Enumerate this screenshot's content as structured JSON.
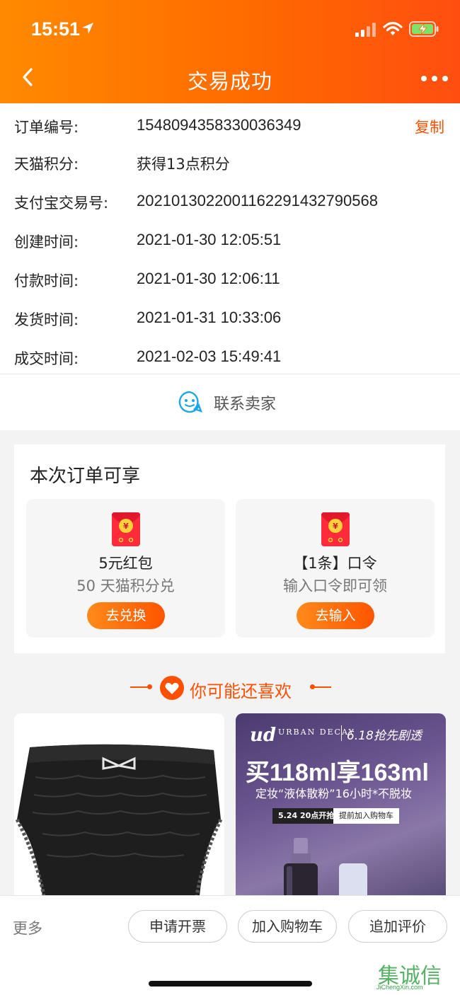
{
  "status_bar": {
    "time": "15:51"
  },
  "header": {
    "title": "交易成功"
  },
  "order": {
    "rows": [
      {
        "key": "订单编号:",
        "value": "1548094358330036349"
      },
      {
        "key": "天猫积分:",
        "value": "获得13点积分"
      },
      {
        "key": "支付宝交易号:",
        "value": "2021013022001162291432790568"
      },
      {
        "key": "创建时间:",
        "value": "2021-01-30 12:05:51"
      },
      {
        "key": "付款时间:",
        "value": "2021-01-30 12:06:11"
      },
      {
        "key": "发货时间:",
        "value": "2021-01-31 10:33:06"
      },
      {
        "key": "成交时间:",
        "value": "2021-02-03 15:49:41"
      }
    ],
    "copy_label": "复制",
    "contact_label": "联系卖家"
  },
  "benefits": {
    "title": "本次订单可享",
    "items": [
      {
        "title": "5元红包",
        "subtitle": "50 天猫积分兑",
        "button": "去兑换"
      },
      {
        "title": "【1条】口令",
        "subtitle": "输入口令即可领",
        "button": "去输入"
      }
    ]
  },
  "recommend": {
    "title": "你可能还喜欢",
    "ad": {
      "logo": "ud",
      "brand": "URBAN DECAY",
      "promo": "6.18抢先剧透",
      "headline": "买118ml享163ml",
      "subline": "定妆“液体散粉”16小时*不脱妆",
      "date_tag": "5.24 20点开抢",
      "cart_tag": "提前加入购物车"
    }
  },
  "bottom_bar": {
    "more_label": "更多",
    "buttons": [
      "申请开票",
      "加入购物车",
      "追加评价"
    ]
  },
  "watermark": {
    "text": "集诚信",
    "sub": "JiChengXin.com"
  },
  "colors": {
    "accent": "#ff5000",
    "header_start": "#ff8a00",
    "header_end": "#ff4e10"
  }
}
